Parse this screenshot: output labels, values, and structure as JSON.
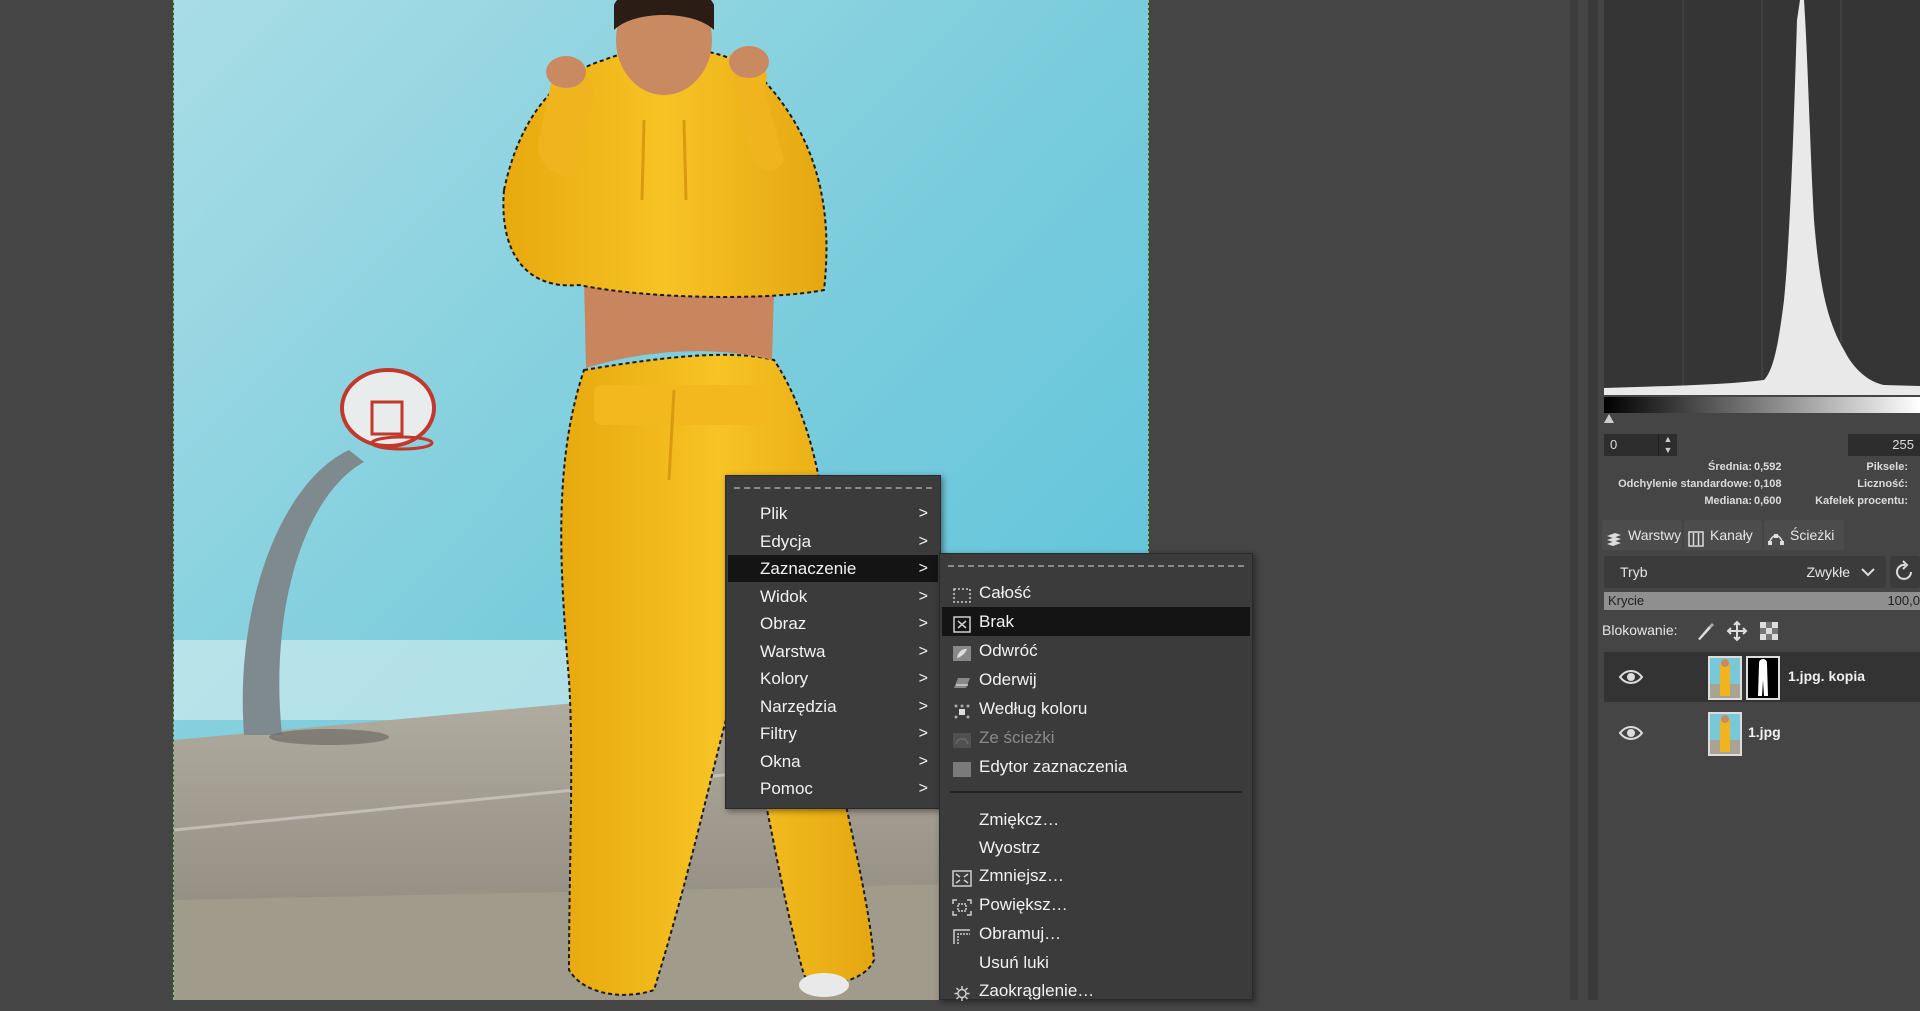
{
  "menu": {
    "items": [
      {
        "label": "Plik"
      },
      {
        "label": "Edycja"
      },
      {
        "label": "Zaznaczenie"
      },
      {
        "label": "Widok"
      },
      {
        "label": "Obraz"
      },
      {
        "label": "Warstwa"
      },
      {
        "label": "Kolory"
      },
      {
        "label": "Narzędzia"
      },
      {
        "label": "Filtry"
      },
      {
        "label": "Okna"
      },
      {
        "label": "Pomoc"
      }
    ],
    "highlighted": "Zaznaczenie",
    "arrow": ">"
  },
  "submenu": {
    "items": [
      {
        "label": "Całość",
        "icon": "select-all-icon"
      },
      {
        "label": "Brak",
        "icon": "select-none-icon"
      },
      {
        "label": "Odwróć",
        "icon": "invert-selection-icon"
      },
      {
        "label": "Oderwij",
        "icon": "float-selection-icon"
      },
      {
        "label": "Według koloru",
        "icon": "select-by-color-icon"
      },
      {
        "label": "Ze ścieżki",
        "icon": "from-path-icon"
      },
      {
        "label": "Edytor zaznaczenia",
        "icon": "selection-editor-icon"
      },
      {
        "label": "Zmiękcz…",
        "icon": ""
      },
      {
        "label": "Wyostrz",
        "icon": ""
      },
      {
        "label": "Zmniejsz…",
        "icon": "shrink-icon"
      },
      {
        "label": "Powiększ…",
        "icon": "grow-icon"
      },
      {
        "label": "Obramuj…",
        "icon": "border-icon"
      },
      {
        "label": "Usuń luki",
        "icon": ""
      },
      {
        "label": "Zaokrąglenie…",
        "icon": "gear-icon"
      }
    ],
    "highlighted": "Brak",
    "disabled": "Ze ścieżki"
  },
  "histogram": {
    "range_min": "0",
    "range_max": "255",
    "stats_left": [
      {
        "label": "Średnia:",
        "value": "0,592"
      },
      {
        "label": "Odchylenie standardowe:",
        "value": "0,108"
      },
      {
        "label": "Mediana:",
        "value": "0,600"
      }
    ],
    "stats_right": [
      "Piksele:",
      "Liczność:",
      "Kafelek procentu:"
    ]
  },
  "dock": {
    "tabs": [
      {
        "label": "Warstwy",
        "icon": "layers-icon"
      },
      {
        "label": "Kanały",
        "icon": "channels-icon"
      },
      {
        "label": "Ścieżki",
        "icon": "paths-icon"
      }
    ],
    "mode_label": "Tryb",
    "mode_value": "Zwykłe",
    "opacity_label": "Krycie",
    "opacity_value": "100,0",
    "lock_label": "Blokowanie:",
    "layers": [
      {
        "name": "1.jpg. kopia",
        "selected": true
      },
      {
        "name": "1.jpg",
        "selected": false
      }
    ]
  },
  "colors": {
    "background": "#454545",
    "menu_bg": "#3b3b3b",
    "menu_highlight": "#141414",
    "selection_marker": "#7acb5a"
  }
}
